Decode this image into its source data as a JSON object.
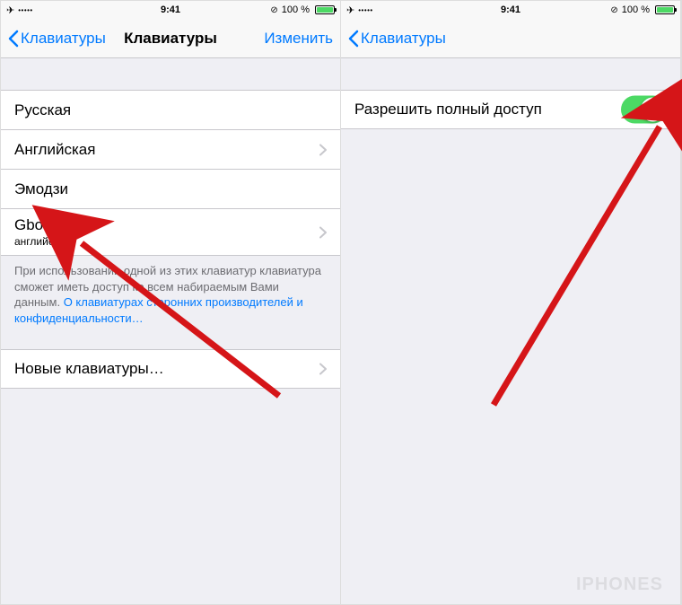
{
  "statusbar": {
    "time": "9:41",
    "battery": "100 %",
    "rotation_lock": "⟳"
  },
  "left": {
    "back_label": "Клавиатуры",
    "title": "Клавиатуры",
    "edit_label": "Изменить",
    "rows": {
      "r0": "Русская",
      "r1": "Английская",
      "r2": "Эмодзи",
      "r3": "Gboard",
      "r3_sub": "английский"
    },
    "footer_text": "При использовании одной из этих клавиатур клавиатура сможет иметь доступ ко всем набираемым Вами данным. ",
    "footer_link": "О клавиатурах сторонних производителей и конфиденциальности…",
    "new_kb": "Новые клавиатуры…"
  },
  "right": {
    "back_label": "Клавиатуры",
    "row0": "Разрешить полный доступ"
  },
  "watermark": "IPHONES"
}
